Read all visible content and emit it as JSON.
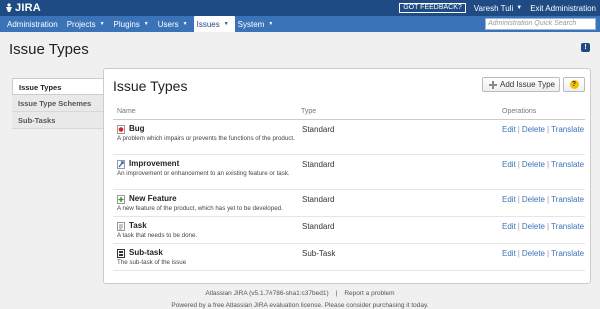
{
  "header": {
    "logo_text": "JIRA",
    "feedback_label": "GOT FEEDBACK?",
    "user_name": "Varesh Tuli",
    "exit_label": "Exit Administration"
  },
  "nav": {
    "items": [
      {
        "label": "Administration",
        "has_dropdown": false
      },
      {
        "label": "Projects",
        "has_dropdown": true
      },
      {
        "label": "Plugins",
        "has_dropdown": true
      },
      {
        "label": "Users",
        "has_dropdown": true
      },
      {
        "label": "Issues",
        "has_dropdown": true,
        "active": true
      },
      {
        "label": "System",
        "has_dropdown": true
      }
    ],
    "search_placeholder": "Administration Quick Search"
  },
  "page": {
    "title": "Issue Types"
  },
  "sidebar": {
    "items": [
      {
        "label": "Issue Types",
        "active": true
      },
      {
        "label": "Issue Type Schemes",
        "active": false
      },
      {
        "label": "Sub-Tasks",
        "active": false
      }
    ]
  },
  "panel": {
    "title": "Issue Types",
    "add_label": "Add Issue Type",
    "help_label": "?",
    "columns": {
      "name": "Name",
      "type": "Type",
      "operations": "Operations"
    },
    "rows": [
      {
        "name": "Bug",
        "icon": "bug-icon",
        "description": "A problem which impairs or prevents the functions of the product.",
        "type": "Standard",
        "edit": "Edit",
        "delete": "Delete",
        "translate": "Translate"
      },
      {
        "name": "Improvement",
        "icon": "improvement-icon",
        "description": "An improvement or enhancement to an existing feature or task.",
        "type": "Standard",
        "edit": "Edit",
        "delete": "Delete",
        "translate": "Translate"
      },
      {
        "name": "New Feature",
        "icon": "new-feature-icon",
        "description": "A new feature of the product, which has yet to be developed.",
        "type": "Standard",
        "edit": "Edit",
        "delete": "Delete",
        "translate": "Translate"
      },
      {
        "name": "Task",
        "icon": "task-icon",
        "description": "A task that needs to be done.",
        "type": "Standard",
        "edit": "Edit",
        "delete": "Delete",
        "translate": "Translate"
      },
      {
        "name": "Sub-task",
        "icon": "sub-task-icon",
        "description": "The sub-task of the issue",
        "type": "Sub-Task",
        "edit": "Edit",
        "delete": "Delete",
        "translate": "Translate"
      }
    ]
  },
  "footer": {
    "version": "Atlassian JIRA (v5.1.7#786-sha1:c37bed1)",
    "report": "Report a problem",
    "license": "Powered by a free Atlassian JIRA evaluation license. Please consider purchasing it today."
  },
  "colors": {
    "header": "#1e4b83",
    "nav": "#3b73b9",
    "link": "#3b73b9"
  }
}
